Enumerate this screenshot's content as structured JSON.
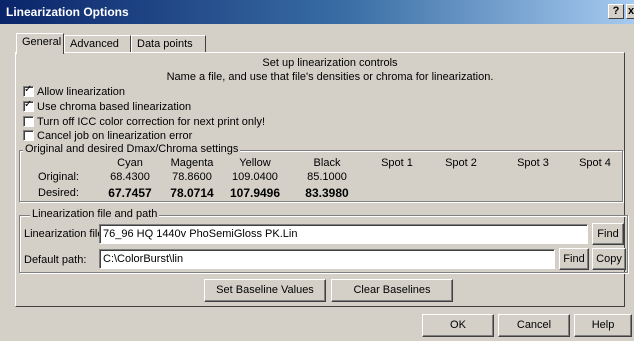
{
  "window": {
    "title": "Linearization Options",
    "help_btn": "?",
    "close_btn": "x"
  },
  "tabs": [
    {
      "label": "General",
      "active": true
    },
    {
      "label": "Advanced",
      "active": false
    },
    {
      "label": "Data points",
      "active": false
    }
  ],
  "intro": {
    "line1": "Set up linearization controls",
    "line2": "Name a file, and use that file's densities or chroma for linearization."
  },
  "options": [
    {
      "label": "Allow linearization",
      "checked": true
    },
    {
      "label": "Use chroma based linearization",
      "checked": true
    },
    {
      "label": "Turn off ICC color correction for next print only!",
      "checked": false
    },
    {
      "label": "Cancel job on linearization error",
      "checked": false
    }
  ],
  "dmax": {
    "legend": "Original and desired Dmax/Chroma settings",
    "columns": [
      "Cyan",
      "Magenta",
      "Yellow",
      "Black",
      "Spot 1",
      "Spot 2",
      "Spot 3",
      "Spot 4"
    ],
    "row_original_label": "Original:",
    "row_desired_label": "Desired:",
    "original": [
      "68.4300",
      "78.8600",
      "109.0400",
      "85.1000"
    ],
    "desired": [
      "67.7457",
      "78.0714",
      "107.9496",
      "83.3980"
    ]
  },
  "file": {
    "legend": "Linearization file and path",
    "lin_label": "Linearization file:",
    "lin_value": "76_96 HQ 1440v PhoSemiGloss PK.Lin",
    "path_label": "Default path:",
    "path_value": "C:\\ColorBurst\\lin",
    "find_label": "Find",
    "copy_label": "Copy"
  },
  "baseline": {
    "set_label": "Set Baseline Values",
    "clear_label": "Clear Baselines"
  },
  "footer": {
    "ok": "OK",
    "cancel": "Cancel",
    "help": "Help"
  }
}
